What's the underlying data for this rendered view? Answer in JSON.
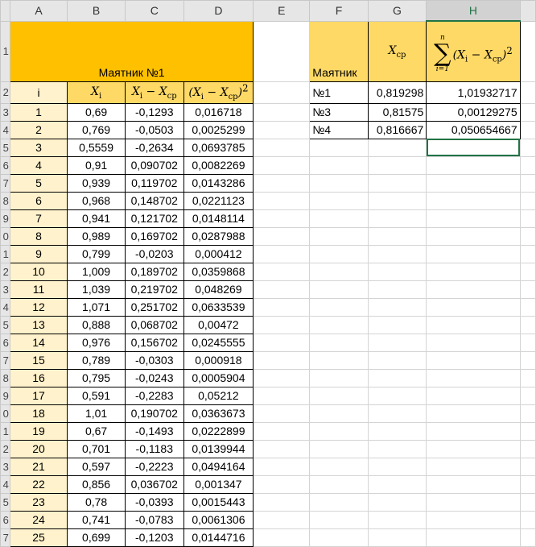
{
  "columns": [
    "A",
    "B",
    "C",
    "D",
    "E",
    "F",
    "G",
    "H"
  ],
  "selected_column": "H",
  "left_table": {
    "title": "Маятник №1",
    "index_header": "i",
    "headers": [
      [
        {
          "t": "X",
          "sub": "i"
        }
      ],
      [
        {
          "t": "X",
          "sub": "i"
        },
        {
          "t": " − "
        },
        {
          "t": "X",
          "sub": "ср"
        }
      ],
      [
        {
          "t": "(X",
          "sub": "i"
        },
        {
          "t": " − "
        },
        {
          "t": "X",
          "sub": "ср"
        },
        {
          "t": ")",
          "sup": "2"
        }
      ]
    ],
    "rows": [
      [
        "1",
        "0,69",
        "-0,1293",
        "0,016718"
      ],
      [
        "2",
        "0,769",
        "-0,0503",
        "0,0025299"
      ],
      [
        "3",
        "0,5559",
        "-0,2634",
        "0,0693785"
      ],
      [
        "4",
        "0,91",
        "0,090702",
        "0,0082269"
      ],
      [
        "5",
        "0,939",
        "0,119702",
        "0,0143286"
      ],
      [
        "6",
        "0,968",
        "0,148702",
        "0,0221123"
      ],
      [
        "7",
        "0,941",
        "0,121702",
        "0,0148114"
      ],
      [
        "8",
        "0,989",
        "0,169702",
        "0,0287988"
      ],
      [
        "9",
        "0,799",
        "-0,0203",
        "0,000412"
      ],
      [
        "10",
        "1,009",
        "0,189702",
        "0,0359868"
      ],
      [
        "11",
        "1,039",
        "0,219702",
        "0,048269"
      ],
      [
        "12",
        "1,071",
        "0,251702",
        "0,0633539"
      ],
      [
        "13",
        "0,888",
        "0,068702",
        "0,00472"
      ],
      [
        "14",
        "0,976",
        "0,156702",
        "0,0245555"
      ],
      [
        "15",
        "0,789",
        "-0,0303",
        "0,000918"
      ],
      [
        "16",
        "0,795",
        "-0,0243",
        "0,0005904"
      ],
      [
        "17",
        "0,591",
        "-0,2283",
        "0,05212"
      ],
      [
        "18",
        "1,01",
        "0,190702",
        "0,0363673"
      ],
      [
        "19",
        "0,67",
        "-0,1493",
        "0,0222899"
      ],
      [
        "20",
        "0,701",
        "-0,1183",
        "0,0139944"
      ],
      [
        "21",
        "0,597",
        "-0,2223",
        "0,0494164"
      ],
      [
        "22",
        "0,856",
        "0,036702",
        "0,001347"
      ],
      [
        "23",
        "0,78",
        "-0,0393",
        "0,0015443"
      ],
      [
        "24",
        "0,741",
        "-0,0783",
        "0,0061306"
      ],
      [
        "25",
        "0,699",
        "-0,1203",
        "0,0144716"
      ]
    ]
  },
  "right_table": {
    "header_label": "Маятник",
    "mean_header": {
      "t": "X",
      "sub": "ср"
    },
    "sum_header": {
      "upper": "n",
      "lower": "i=1",
      "sigma": "∑",
      "expr": [
        {
          "t": "(X",
          "sub": "i"
        },
        {
          "t": " − "
        },
        {
          "t": "X",
          "sub": "ср"
        },
        {
          "t": ")",
          "sup": "2"
        }
      ]
    },
    "rows": [
      [
        "№1",
        "0,819298",
        "1,01932717"
      ],
      [
        "№3",
        "0,81575",
        "0,00129275"
      ],
      [
        "№4",
        "0,816667",
        "0,050654667"
      ]
    ]
  }
}
